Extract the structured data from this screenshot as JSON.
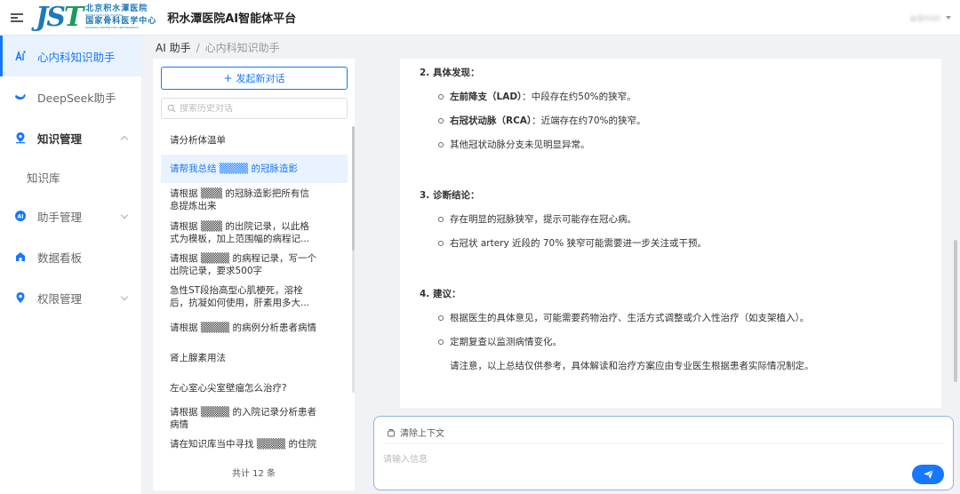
{
  "header": {
    "logo_mark": "JST",
    "logo_cn_1": "北京积水潭医院",
    "logo_en_1": "BEIJING JISHUITAN HOSPITAL",
    "logo_cn_2": "国家骨科医学中心",
    "logo_en_2": "NATIONAL CENTER FOR ORTHOPAEDICS",
    "title": "积水潭医院AI智能体平台",
    "user": "admin"
  },
  "sidebar": {
    "items": [
      {
        "label": "心内科知识助手"
      },
      {
        "label": "DeepSeek助手"
      },
      {
        "label": "知识管理"
      },
      {
        "label": "知识库"
      },
      {
        "label": "助手管理"
      },
      {
        "label": "数据看板"
      },
      {
        "label": "权限管理"
      }
    ]
  },
  "breadcrumb": {
    "root": "AI 助手",
    "sep": "/",
    "current": "心内科知识助手"
  },
  "history": {
    "new_chat_label": "发起新对话",
    "search_placeholder": "搜索历史对话",
    "items": [
      {
        "l1": "请分析体温单",
        "l2": ""
      },
      {
        "l1": "请帮我总结 ▒▒▒▒ 的冠脉造影",
        "l2": ""
      },
      {
        "l1": "请根据 ▒▒▒ 的冠脉造影把所有信",
        "l2": "息提炼出来"
      },
      {
        "l1": "请根据 ▒▒▒ 的出院记录，以此格",
        "l2": "式为模板，加上范围幅的病程记..."
      },
      {
        "l1": "请根据 ▒▒▒▒ 的病程记录，写一个",
        "l2": "出院记录，要求500字"
      },
      {
        "l1": "急性ST段抬高型心肌梗死，溶栓",
        "l2": "后，抗凝如何使用，肝素用多大..."
      },
      {
        "l1": "请根据 ▒▒▒▒ 的病例分析患者病情",
        "l2": ""
      },
      {
        "l1": "肾上腺素用法",
        "l2": ""
      },
      {
        "l1": "左心室心尖室壁瘤怎么治疗?",
        "l2": ""
      },
      {
        "l1": "请根据 ▒▒▒▒ 的入院记录分析患者",
        "l2": "病情"
      },
      {
        "l1": "请在知识库当中寻找 ▒▒▒▒ 的住院",
        "l2": ""
      }
    ],
    "count": "共计 12 条"
  },
  "content": {
    "s2_title": "2. 具体发现：",
    "s2_b1_bold": "左前降支（LAD）",
    "s2_b1_text": "：中段存在约50%的狭窄。",
    "s2_b2_bold": "右冠状动脉（RCA）",
    "s2_b2_text": "：近端存在约70%的狭窄。",
    "s2_b3": "其他冠状动脉分支未见明显异常。",
    "s3_title": "3. 诊断结论：",
    "s3_b1": "存在明显的冠脉狭窄，提示可能存在冠心病。",
    "s3_b2": "右冠状 artery 近段的 70% 狭窄可能需要进一步关注或干预。",
    "s4_title": "4. 建议：",
    "s4_b1": "根据医生的具体意见，可能需要药物治疗、生活方式调整或介入性治疗（如支架植入）。",
    "s4_b2": "定期复查以监测病情变化。",
    "s4_note": "请注意，以上总结仅供参考，具体解读和治疗方案应由专业医生根据患者实际情况制定。"
  },
  "composer": {
    "clear_label": "清除上下文",
    "placeholder": "请输入信息"
  },
  "colors": {
    "accent": "#1677ff",
    "active_bg": "#e8f3ff",
    "logo_blue": "#1d7ab8",
    "logo_green": "#1d9b5a"
  }
}
